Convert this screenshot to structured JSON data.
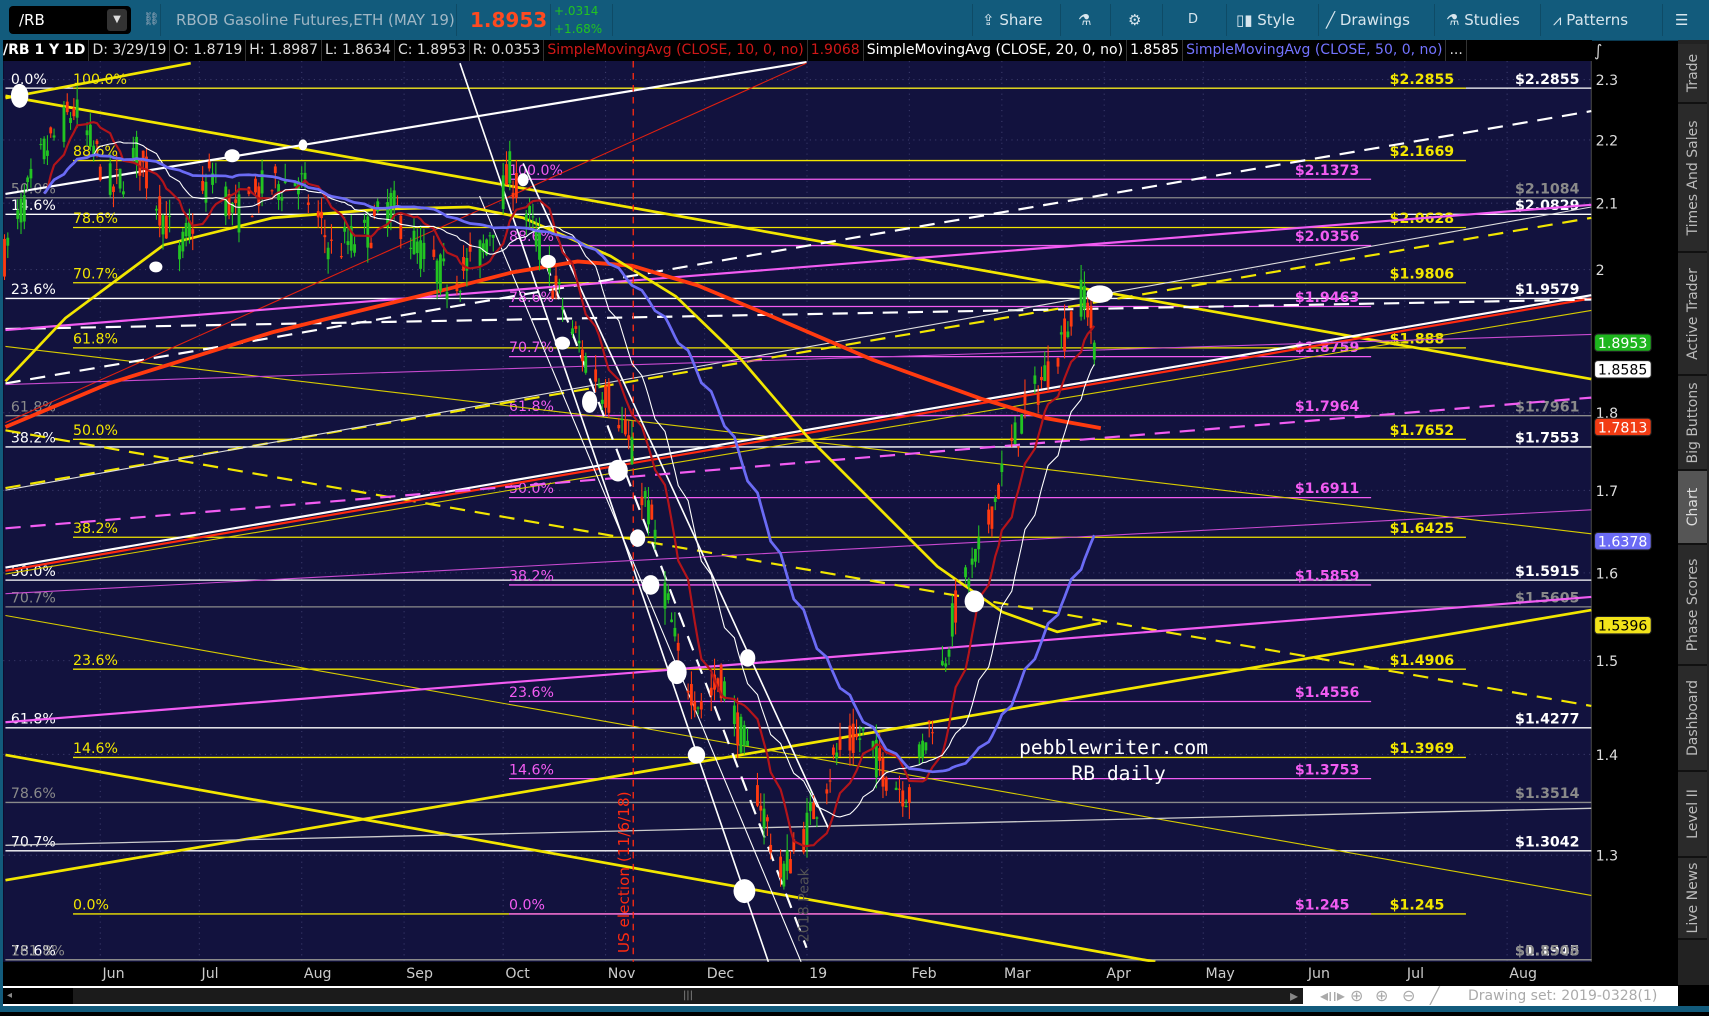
{
  "toolbar": {
    "symbol": "/RB",
    "description": "RBOB Gasoline Futures,ETH (MAY 19)",
    "last": "1.8953",
    "change": "+.0314",
    "change_pct": "+1.68%",
    "share": "Share",
    "period": "D",
    "style": "Style",
    "drawings": "Drawings",
    "studies": "Studies",
    "patterns": "Patterns"
  },
  "infobar": {
    "symbol_period": "/RB 1 Y 1D",
    "date": "D: 3/29/19",
    "open": "O: 1.8719",
    "high": "H: 1.8987",
    "low": "L: 1.8634",
    "close": "C: 1.8953",
    "range": "R: 0.0353",
    "sma10_label": "SimpleMovingAvg (CLOSE, 10, 0, no)",
    "sma10_value": "1.9068",
    "sma20_label": "SimpleMovingAvg (CLOSE, 20, 0, no)",
    "sma20_value": "1.8585",
    "sma50_label": "SimpleMovingAvg (CLOSE, 50, 0, no)",
    "more": "..."
  },
  "right_tabs": [
    "Trade",
    "Times And Sales",
    "Active Trader",
    "Big Buttons",
    "Chart",
    "Phase Scores",
    "Dashboard",
    "Level II",
    "Live News"
  ],
  "bottom": {
    "drawing_set": "Drawing set: 2019-0328(1)"
  },
  "colors": {
    "up": "#22c322",
    "down": "#ff3a10",
    "sma10": "#b3141a",
    "sma20": "#ffffff",
    "sma50": "#6b6bf5",
    "background": "#12123e"
  },
  "chart_data": {
    "type": "candlestick",
    "title": "RBOB Gasoline Futures /RB daily",
    "scale": "log",
    "ylim": [
      1.2,
      2.33
    ],
    "price_axis": {
      "ticks": [
        "2.3",
        "2.2",
        "2.1",
        "2",
        "1.8",
        "1.7",
        "1.6",
        "1.5",
        "1.4",
        "1.3"
      ]
    },
    "time_axis": [
      {
        "label": "Jun",
        "date": "2018-06-01"
      },
      {
        "label": "Jul",
        "date": "2018-07-01"
      },
      {
        "label": "Aug",
        "date": "2018-08-01"
      },
      {
        "label": "Sep",
        "date": "2018-09-01"
      },
      {
        "label": "Oct",
        "date": "2018-10-01"
      },
      {
        "label": "Nov",
        "date": "2018-11-01"
      },
      {
        "label": "Dec",
        "date": "2018-12-01"
      },
      {
        "label": "19",
        "date": "2019-01-01"
      },
      {
        "label": "Feb",
        "date": "2019-02-01"
      },
      {
        "label": "Mar",
        "date": "2019-03-01"
      },
      {
        "label": "Apr",
        "date": "2019-04-01"
      },
      {
        "label": "May",
        "date": "2019-05-01"
      },
      {
        "label": "Jun",
        "date": "2019-06-01"
      },
      {
        "label": "Jul",
        "date": "2019-07-01"
      },
      {
        "label": "Aug",
        "date": "2019-08-01"
      }
    ],
    "close_anchors": [
      [
        "2018-05-03",
        2.02
      ],
      [
        "2018-05-15",
        2.18
      ],
      [
        "2018-05-24",
        2.25
      ],
      [
        "2018-06-05",
        2.12
      ],
      [
        "2018-06-12",
        2.18
      ],
      [
        "2018-06-25",
        2.02
      ],
      [
        "2018-07-05",
        2.15
      ],
      [
        "2018-07-12",
        2.08
      ],
      [
        "2018-07-20",
        2.12
      ],
      [
        "2018-07-31",
        2.14
      ],
      [
        "2018-08-10",
        2.03
      ],
      [
        "2018-08-20",
        2.05
      ],
      [
        "2018-08-28",
        2.1
      ],
      [
        "2018-09-05",
        2.03
      ],
      [
        "2018-09-15",
        1.98
      ],
      [
        "2018-09-25",
        2.03
      ],
      [
        "2018-10-03",
        2.15
      ],
      [
        "2018-10-10",
        2.06
      ],
      [
        "2018-10-18",
        1.96
      ],
      [
        "2018-10-25",
        1.88
      ],
      [
        "2018-11-05",
        1.8
      ],
      [
        "2018-11-15",
        1.66
      ],
      [
        "2018-11-23",
        1.5
      ],
      [
        "2018-11-30",
        1.45
      ],
      [
        "2018-12-06",
        1.48
      ],
      [
        "2018-12-14",
        1.4
      ],
      [
        "2018-12-24",
        1.28
      ],
      [
        "2018-12-31",
        1.32
      ],
      [
        "2019-01-10",
        1.4
      ],
      [
        "2019-01-18",
        1.42
      ],
      [
        "2019-01-25",
        1.38
      ],
      [
        "2019-02-01",
        1.36
      ],
      [
        "2019-02-08",
        1.44
      ],
      [
        "2019-02-15",
        1.56
      ],
      [
        "2019-02-22",
        1.62
      ],
      [
        "2019-03-01",
        1.72
      ],
      [
        "2019-03-08",
        1.8
      ],
      [
        "2019-03-15",
        1.86
      ],
      [
        "2019-03-22",
        1.93
      ],
      [
        "2019-03-26",
        1.97
      ],
      [
        "2019-03-29",
        1.8953
      ]
    ],
    "last_bar": {
      "date": "3/29/19",
      "open": 1.8719,
      "high": 1.8987,
      "low": 1.8634,
      "close": 1.8953
    },
    "badges": [
      {
        "value": "1.8953",
        "price": 1.8953,
        "bg": "#1db51d",
        "fg": "#ffffff"
      },
      {
        "value": "1.8585",
        "price": 1.8585,
        "bg": "#ffffff",
        "fg": "#000000"
      },
      {
        "value": "1.7813",
        "price": 1.7813,
        "bg": "#f23c14",
        "fg": "#ffffff"
      },
      {
        "value": "1.6378",
        "price": 1.6378,
        "bg": "#6b6bf5",
        "fg": "#ffffff"
      },
      {
        "value": "1.5396",
        "price": 1.5396,
        "bg": "#f2e41a",
        "fg": "#000000"
      }
    ],
    "fib_sets": [
      {
        "name": "white",
        "color": "#ffffff",
        "levels": [
          {
            "pct": "0.0%",
            "price": 2.2855,
            "price_label": "$2.2855"
          },
          {
            "pct": "14.6%",
            "price": 2.0829,
            "price_label": "$2.0829"
          },
          {
            "pct": "23.6%",
            "price": 1.9579,
            "price_label": "$1.9579"
          },
          {
            "pct": "38.2%",
            "price": 1.7553,
            "price_label": "$1.7553"
          },
          {
            "pct": "50.0%",
            "price": 1.5915,
            "price_label": "$1.5915"
          },
          {
            "pct": "61.8%",
            "price": 1.4277,
            "price_label": "$1.4277"
          },
          {
            "pct": "70.7%",
            "price": 1.3042,
            "price_label": "$1.3042"
          },
          {
            "pct": "78.6%",
            "price": 1.1945,
            "price_label": "$1.1945"
          }
        ]
      },
      {
        "name": "gray",
        "color": "#8a8a8a",
        "levels": [
          {
            "pct": "50.0%",
            "price": 2.1084,
            "price_label": "$2.1084"
          },
          {
            "pct": "61.8%",
            "price": 1.7961,
            "price_label": "$1.7961"
          },
          {
            "pct": "70.7%",
            "price": 1.5605,
            "price_label": "$1.5605"
          },
          {
            "pct": "78.6%",
            "price": 1.3514,
            "price_label": "$1.3514"
          },
          {
            "pct": "161.8%",
            "price": 0.8508,
            "price_label": "$0.8508"
          }
        ]
      },
      {
        "name": "yellow",
        "color": "#f2e600",
        "levels": [
          {
            "pct": "100.0%",
            "price": 2.2855,
            "price_label": "$2.2855"
          },
          {
            "pct": "88.6%",
            "price": 2.1669,
            "price_label": "$2.1669"
          },
          {
            "pct": "78.6%",
            "price": 2.0628,
            "price_label": "$2.0628"
          },
          {
            "pct": "70.7%",
            "price": 1.9806,
            "price_label": "$1.9806"
          },
          {
            "pct": "61.8%",
            "price": 1.888,
            "price_label": "$1.888"
          },
          {
            "pct": "50.0%",
            "price": 1.7652,
            "price_label": "$1.7652"
          },
          {
            "pct": "38.2%",
            "price": 1.6425,
            "price_label": "$1.6425"
          },
          {
            "pct": "23.6%",
            "price": 1.4906,
            "price_label": "$1.4906"
          },
          {
            "pct": "14.6%",
            "price": 1.3969,
            "price_label": "$1.3969"
          },
          {
            "pct": "0.0%",
            "price": 1.245,
            "price_label": "$1.245"
          }
        ]
      },
      {
        "name": "magenta",
        "color": "#f25cf2",
        "levels": [
          {
            "pct": "100.0%",
            "price": 2.1373,
            "price_label": "$2.1373"
          },
          {
            "pct": "88.6%",
            "price": 2.0356,
            "price_label": "$2.0356"
          },
          {
            "pct": "78.6%",
            "price": 1.9463,
            "price_label": "$1.9463"
          },
          {
            "pct": "70.7%",
            "price": 1.8759,
            "price_label": "$1.8759"
          },
          {
            "pct": "61.8%",
            "price": 1.7964,
            "price_label": "$1.7964"
          },
          {
            "pct": "50.0%",
            "price": 1.6911,
            "price_label": "$1.6911"
          },
          {
            "pct": "38.2%",
            "price": 1.5859,
            "price_label": "$1.5859"
          },
          {
            "pct": "23.6%",
            "price": 1.4556,
            "price_label": "$1.4556"
          },
          {
            "pct": "14.6%",
            "price": 1.3753,
            "price_label": "$1.3753"
          },
          {
            "pct": "0.0%",
            "price": 1.245,
            "price_label": "$1.245"
          }
        ]
      }
    ],
    "annotations": {
      "election": "US election (11/6/18)",
      "peak": "2018 Peak",
      "watermark1": "pebblewriter.com",
      "watermark2": "RB daily"
    }
  }
}
